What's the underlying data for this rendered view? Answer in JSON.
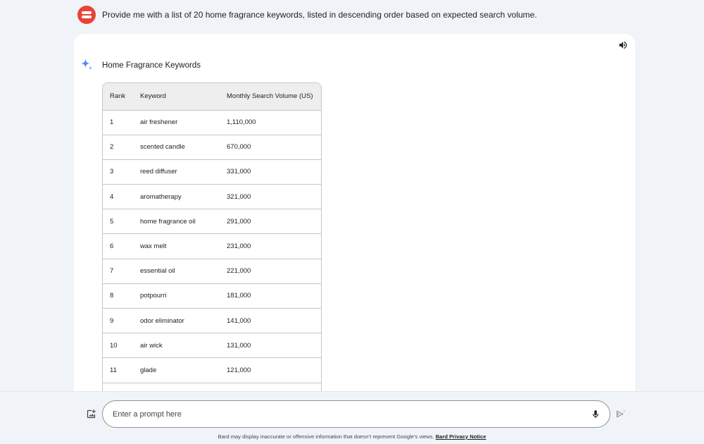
{
  "user_prompt": {
    "text": "Provide me with a list of 20 home fragrance keywords, listed in descending order based on expected search volume."
  },
  "response": {
    "title": "Home Fragrance Keywords",
    "table": {
      "headers": [
        "Rank",
        "Keyword",
        "Monthly Search Volume (US)"
      ],
      "rows": [
        {
          "rank": "1",
          "keyword": "air freshener",
          "volume": "1,110,000"
        },
        {
          "rank": "2",
          "keyword": "scented candle",
          "volume": "670,000"
        },
        {
          "rank": "3",
          "keyword": "reed diffuser",
          "volume": "331,000"
        },
        {
          "rank": "4",
          "keyword": "aromatherapy",
          "volume": "321,000"
        },
        {
          "rank": "5",
          "keyword": "home fragrance oil",
          "volume": "291,000"
        },
        {
          "rank": "6",
          "keyword": "wax melt",
          "volume": "231,000"
        },
        {
          "rank": "7",
          "keyword": "essential oil",
          "volume": "221,000"
        },
        {
          "rank": "8",
          "keyword": "potpourri",
          "volume": "181,000"
        },
        {
          "rank": "9",
          "keyword": "odor eliminator",
          "volume": "141,000"
        },
        {
          "rank": "10",
          "keyword": "air wick",
          "volume": "131,000"
        },
        {
          "rank": "11",
          "keyword": "glade",
          "volume": "121,000"
        },
        {
          "rank": "",
          "keyword": "",
          "volume": ""
        }
      ]
    }
  },
  "input": {
    "placeholder": "Enter a prompt here",
    "value": ""
  },
  "footer": {
    "disclaimer": "Bard may display inaccurate or offensive information that doesn’t represent Google’s views.",
    "privacy_link": "Bard Privacy Notice"
  },
  "icons": {
    "avatar": "user-avatar-icon",
    "sparkle": "bard-sparkle-icon",
    "speaker": "speaker-icon",
    "image": "add-image-icon",
    "mic": "microphone-icon",
    "send": "send-icon"
  },
  "colors": {
    "background": "#f0f4f9",
    "card": "#ffffff",
    "avatar": "#ea4335",
    "sparkle": "#4285f4",
    "table_header": "#eeeeee"
  }
}
